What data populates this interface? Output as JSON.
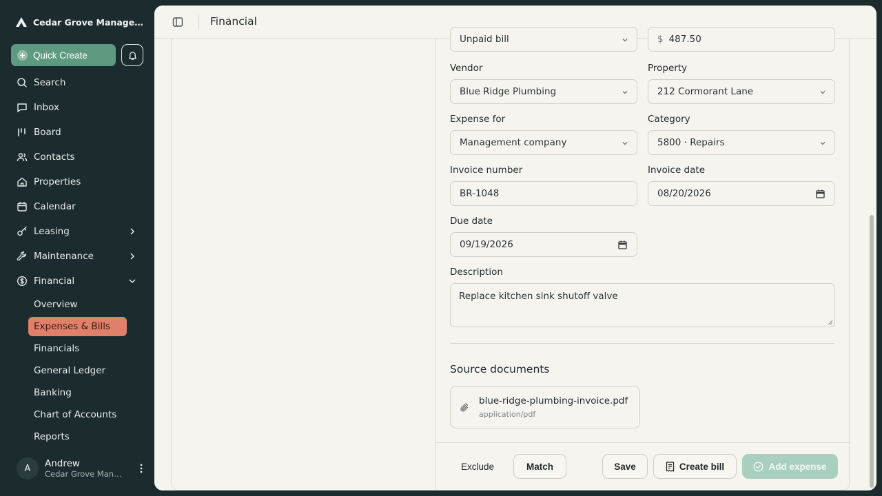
{
  "app": {
    "brand": "Cedar Grove Manageme…"
  },
  "sidebar": {
    "quick_create": "Quick Create",
    "items": [
      {
        "label": "Search",
        "icon": "search-icon"
      },
      {
        "label": "Inbox",
        "icon": "inbox-icon"
      },
      {
        "label": "Board",
        "icon": "board-icon"
      },
      {
        "label": "Contacts",
        "icon": "contacts-icon"
      },
      {
        "label": "Properties",
        "icon": "home-icon"
      },
      {
        "label": "Calendar",
        "icon": "calendar-icon"
      },
      {
        "label": "Leasing",
        "icon": "key-icon"
      },
      {
        "label": "Maintenance",
        "icon": "wrench-icon"
      },
      {
        "label": "Financial",
        "icon": "dollar-icon"
      }
    ],
    "financial_sub": [
      {
        "label": "Overview"
      },
      {
        "label": "Expenses & Bills",
        "active": true
      },
      {
        "label": "Financials"
      },
      {
        "label": "General Ledger"
      },
      {
        "label": "Banking"
      },
      {
        "label": "Chart of Accounts"
      },
      {
        "label": "Reports"
      }
    ],
    "user": {
      "initial": "A",
      "name": "Andrew",
      "org": "Cedar Grove Mana…"
    }
  },
  "header": {
    "title": "Financial"
  },
  "form": {
    "bill_type": "Unpaid bill",
    "amount_currency": "$",
    "amount": "487.50",
    "vendor_label": "Vendor",
    "vendor": "Blue Ridge Plumbing",
    "property_label": "Property",
    "property": "212 Cormorant Lane",
    "expense_for_label": "Expense for",
    "expense_for": "Management company",
    "category_label": "Category",
    "category": "5800 · Repairs",
    "invoice_number_label": "Invoice number",
    "invoice_number": "BR-1048",
    "invoice_date_label": "Invoice date",
    "invoice_date": "08/20/2026",
    "due_date_label": "Due date",
    "due_date": "09/19/2026",
    "description_label": "Description",
    "description": "Replace kitchen sink shutoff valve"
  },
  "documents": {
    "title": "Source documents",
    "file_name": "blue-ridge-plumbing-invoice.pdf",
    "file_type": "application/pdf"
  },
  "actions": {
    "exclude": "Exclude",
    "match": "Match",
    "save": "Save",
    "create_bill": "Create bill",
    "add_expense": "Add expense"
  },
  "colors": {
    "accent_green": "#5d9a80",
    "active_nav": "#e07f6a",
    "sidebar_bg": "#1c2b2d"
  }
}
